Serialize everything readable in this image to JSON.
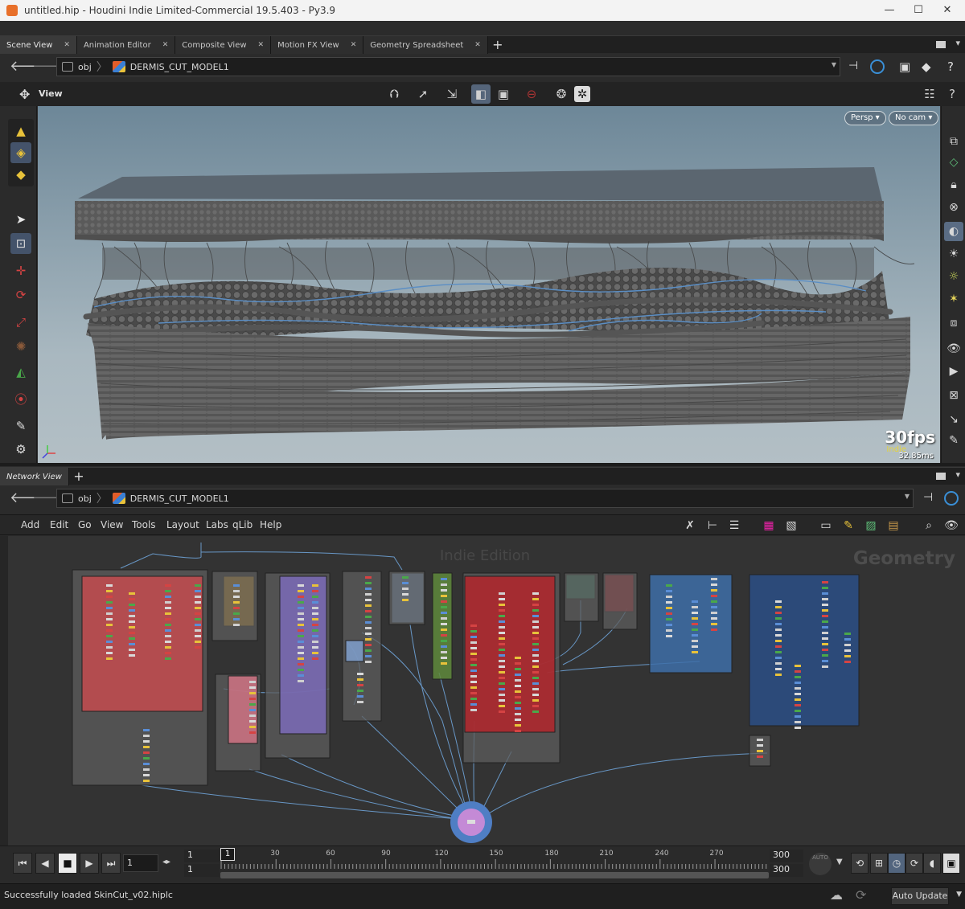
{
  "window": {
    "title": "untitled.hip - Houdini Indie Limited-Commercial 19.5.403 - Py3.9",
    "min": "—",
    "max": "☐",
    "close": "✕"
  },
  "top_tabs": [
    {
      "label": "Scene View",
      "close": "✕",
      "active": true
    },
    {
      "label": "Animation Editor",
      "close": "✕"
    },
    {
      "label": "Composite View",
      "close": "✕"
    },
    {
      "label": "Motion FX View",
      "close": "✕"
    },
    {
      "label": "Geometry Spreadsheet",
      "close": "✕"
    }
  ],
  "scene_path": {
    "root": "obj",
    "node": "DERMIS_CUT_MODEL1"
  },
  "viewer": {
    "label": "View",
    "persp": "Persp ▾",
    "cam": "No cam ▾",
    "fps": "30fps",
    "ms": "32.85ms",
    "watermark": "Indie"
  },
  "network_tabs": [
    {
      "label": "Network View",
      "active": true
    }
  ],
  "network_path": {
    "root": "obj",
    "node": "DERMIS_CUT_MODEL1"
  },
  "network_menu": [
    "Add",
    "Edit",
    "Go",
    "View",
    "Tools",
    "Layout",
    "Labs",
    "qLib",
    "Help"
  ],
  "network": {
    "watermark": "Indie Edition",
    "context": "Geometry"
  },
  "network_boxes": [
    {
      "id": "a",
      "color": "#5e5e5e"
    },
    {
      "id": "b",
      "color": "#c44b4f"
    },
    {
      "id": "c",
      "color": "#d79d2a"
    },
    {
      "id": "d",
      "color": "#7b6bb8"
    },
    {
      "id": "e",
      "color": "#5e5e5e"
    },
    {
      "id": "f",
      "color": "#7f9fcc"
    },
    {
      "id": "g",
      "color": "#5f8a3c"
    },
    {
      "id": "h",
      "color": "#b3262b"
    },
    {
      "id": "i",
      "color": "#3f8870"
    },
    {
      "id": "j",
      "color": "#c1262b"
    },
    {
      "id": "k",
      "color": "#3e6fa8"
    },
    {
      "id": "l",
      "color": "#2b4f86"
    },
    {
      "id": "m",
      "color": "#d07384"
    }
  ],
  "timeline": {
    "current_frame": "1",
    "start": "1",
    "start2": "1",
    "end": "300",
    "end2": "300",
    "marker": "1",
    "ticks": [
      "30",
      "60",
      "90",
      "120",
      "150",
      "180",
      "210",
      "240",
      "270"
    ],
    "auto": "AUTO"
  },
  "status": {
    "message": "Successfully loaded SkinCut_v02.hiplc",
    "auto_update": "Auto Update"
  },
  "colors": {
    "accent": "#5a6c84",
    "viewport_top": "#6d8798",
    "viewport_bottom": "#b3bfc5"
  }
}
